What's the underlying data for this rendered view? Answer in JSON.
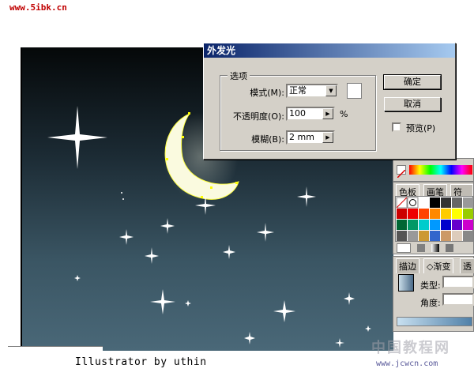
{
  "watermark": {
    "site": "www.5ibk.cn",
    "cn_logo": "中国教程网",
    "cn_url": "www.jcwcn.com"
  },
  "caption": "Illustrator by uthin",
  "dialog": {
    "title": "外发光",
    "group_label": "选项",
    "mode_label": "模式(M):",
    "mode_value": "正常",
    "opacity_label": "不透明度(O):",
    "opacity_value": "100",
    "opacity_unit": "%",
    "blur_label": "模糊(B):",
    "blur_value": "2 mm",
    "ok_label": "确定",
    "cancel_label": "取消",
    "preview_label": "预览(P)",
    "preview_checked": false
  },
  "swatches_panel": {
    "tabs": [
      "色板",
      "画笔",
      "符号"
    ]
  },
  "gradient_panel": {
    "tabs": [
      "描边",
      "渐变",
      "透"
    ],
    "type_label": "类型:",
    "angle_label": "角度:"
  }
}
